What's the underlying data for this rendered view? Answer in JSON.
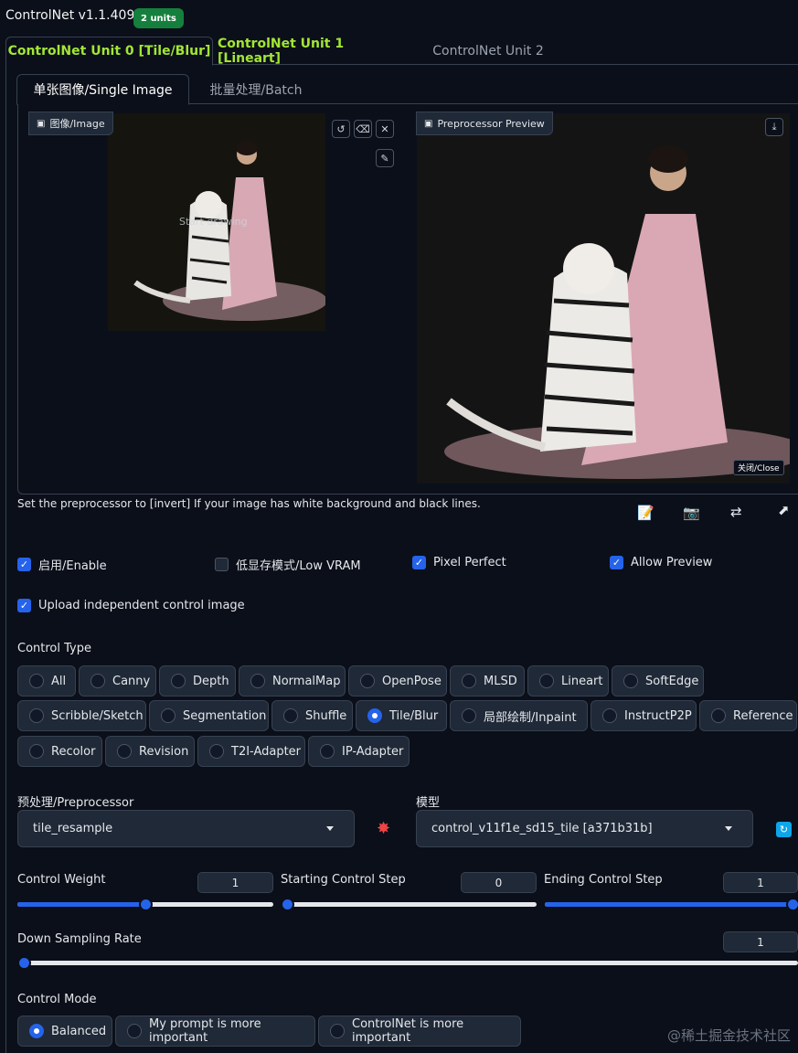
{
  "header": {
    "title": "ControlNet v1.1.409",
    "badge": "2 units"
  },
  "unit_tabs": [
    {
      "label": "ControlNet Unit 0 [Tile/Blur]"
    },
    {
      "label": "ControlNet Unit 1 [Lineart]"
    },
    {
      "label": "ControlNet Unit 2"
    }
  ],
  "mode_tabs": [
    {
      "label": "单张图像/Single Image"
    },
    {
      "label": "批量处理/Batch"
    }
  ],
  "image_panel": {
    "label": "图像/Image",
    "overlay_text": "Start drawing",
    "image_icon": "image-icon"
  },
  "preview_panel": {
    "label": "Preprocessor Preview",
    "close_label": "关闭/Close"
  },
  "hint": "Set the preprocessor to [invert] If your image has white background and black lines.",
  "checkboxes": {
    "enable": {
      "label": "启用/Enable",
      "checked": true
    },
    "low_vram": {
      "label": "低显存模式/Low VRAM",
      "checked": false
    },
    "pixel_perfect": {
      "label": "Pixel Perfect",
      "checked": true
    },
    "allow_preview": {
      "label": "Allow Preview",
      "checked": true
    },
    "upload_independent": {
      "label": "Upload independent control image",
      "checked": true
    }
  },
  "control_type": {
    "label": "Control Type",
    "options": [
      "All",
      "Canny",
      "Depth",
      "NormalMap",
      "OpenPose",
      "MLSD",
      "Lineart",
      "SoftEdge",
      "Scribble/Sketch",
      "Segmentation",
      "Shuffle",
      "Tile/Blur",
      "局部绘制/Inpaint",
      "InstructP2P",
      "Reference",
      "Recolor",
      "Revision",
      "T2I-Adapter",
      "IP-Adapter"
    ],
    "selected": "Tile/Blur"
  },
  "preprocessor": {
    "label": "预处理/Preprocessor",
    "value": "tile_resample"
  },
  "model": {
    "label": "模型",
    "value": "control_v11f1e_sd15_tile [a371b31b]"
  },
  "sliders": {
    "control_weight": {
      "label": "Control Weight",
      "value": "1",
      "fraction": 0.5
    },
    "starting_step": {
      "label": "Starting Control Step",
      "value": "0",
      "fraction": 0
    },
    "ending_step": {
      "label": "Ending Control Step",
      "value": "1",
      "fraction": 1
    },
    "down_sampling": {
      "label": "Down Sampling Rate",
      "value": "1",
      "fraction": 0
    }
  },
  "control_mode": {
    "label": "Control Mode",
    "options": [
      "Balanced",
      "My prompt is more important",
      "ControlNet is more important"
    ],
    "selected": "Balanced"
  },
  "watermark": "@稀土掘金技术社区",
  "colors": {
    "accent": "#2563eb",
    "tab_green": "#a3e635",
    "badge_green": "#15803d",
    "background": "#0b0f19"
  }
}
